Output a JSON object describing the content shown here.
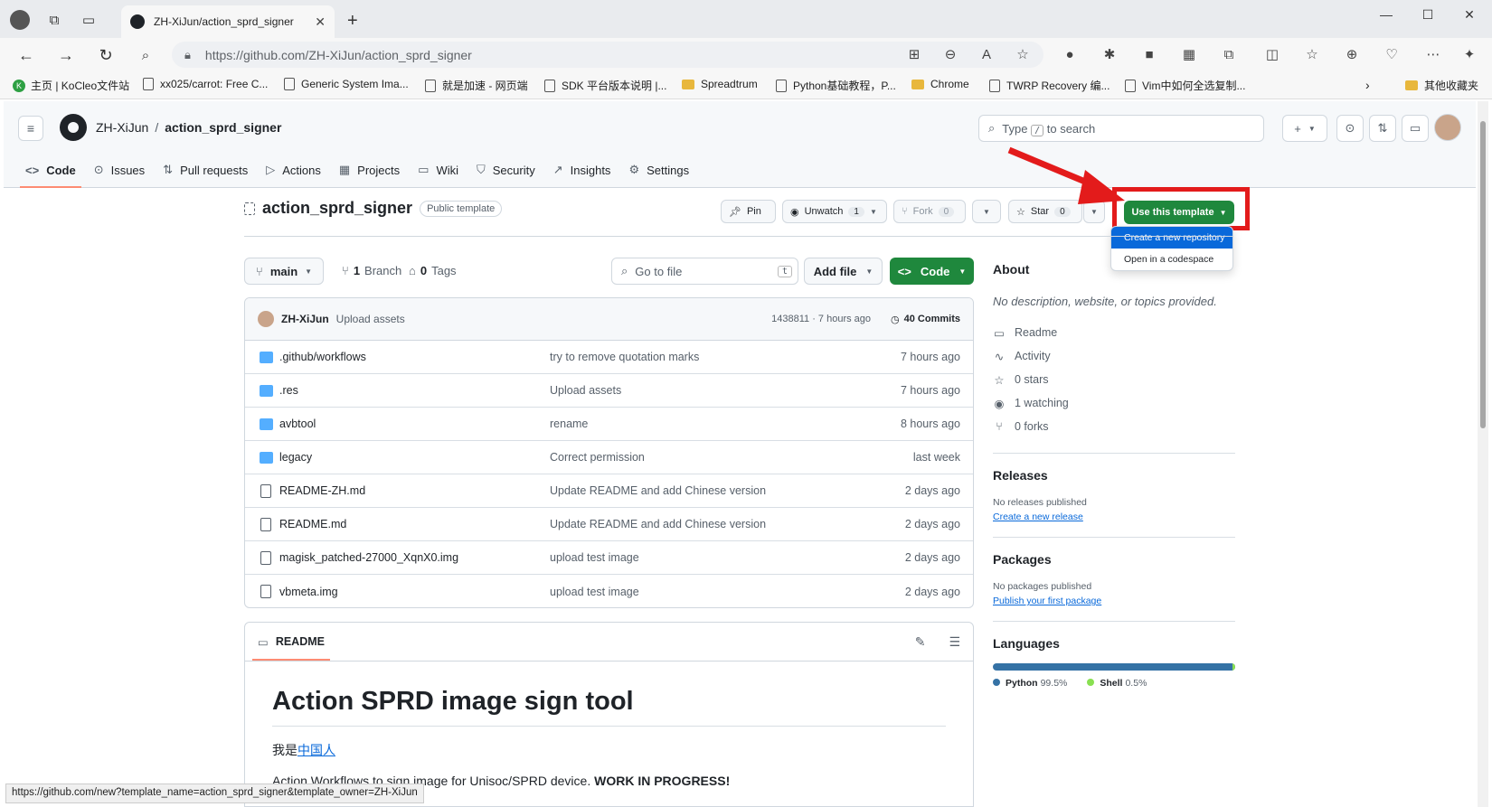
{
  "browser": {
    "tab_title": "ZH-XiJun/action_sprd_signer",
    "url": "https://github.com/ZH-XiJun/action_sprd_signer",
    "bookmarks": [
      "主页 | KoCleo文件站",
      "xx025/carrot: Free C...",
      "Generic System Ima...",
      "就是加速 - 网页端",
      "SDK 平台版本说明 |...",
      "Spreadtrum",
      "Python基础教程，P...",
      "Chrome",
      "TWRP Recovery 编...",
      "Vim中如何全选复制...",
      "其他收藏夹"
    ],
    "status_url": "https://github.com/new?template_name=action_sprd_signer&template_owner=ZH-XiJun"
  },
  "header": {
    "owner": "ZH-XiJun",
    "separator": "/",
    "repo": "action_sprd_signer",
    "search_prefix": "Type",
    "search_key": "/",
    "search_suffix": "to search"
  },
  "repo_tabs": [
    {
      "label": "Code",
      "icon": "<>"
    },
    {
      "label": "Issues",
      "icon": "⊙"
    },
    {
      "label": "Pull requests",
      "icon": "⇅"
    },
    {
      "label": "Actions",
      "icon": "▷"
    },
    {
      "label": "Projects",
      "icon": "▦"
    },
    {
      "label": "Wiki",
      "icon": "▭"
    },
    {
      "label": "Security",
      "icon": "⛉"
    },
    {
      "label": "Insights",
      "icon": "↗"
    },
    {
      "label": "Settings",
      "icon": "⚙"
    }
  ],
  "repo": {
    "name": "action_sprd_signer",
    "visibility": "Public template",
    "pin": "Pin",
    "unwatch": "Unwatch",
    "watch_count": "1",
    "fork": "Fork",
    "fork_count": "0",
    "star": "Star",
    "star_count": "0",
    "use_template": "Use this template"
  },
  "template_menu": {
    "create_repo": "Create a new repository",
    "open_codespace": "Open in a codespace"
  },
  "controls": {
    "branch": "main",
    "branches_count": "1",
    "branches_label": "Branch",
    "tags_count": "0",
    "tags_label": "Tags",
    "goto_placeholder": "Go to file",
    "goto_key": "t",
    "add_file": "Add file",
    "code": "Code"
  },
  "latest_commit": {
    "author": "ZH-XiJun",
    "message": "Upload assets",
    "hash_time": "1438811 · 7 hours ago",
    "commits": "40 Commits"
  },
  "files": [
    {
      "name": ".github/workflows",
      "type": "dir",
      "message": "try to remove quotation marks",
      "time": "7 hours ago"
    },
    {
      "name": ".res",
      "type": "dir",
      "message": "Upload assets",
      "time": "7 hours ago"
    },
    {
      "name": "avbtool",
      "type": "dir",
      "message": "rename",
      "time": "8 hours ago"
    },
    {
      "name": "legacy",
      "type": "dir",
      "message": "Correct permission",
      "time": "last week"
    },
    {
      "name": "README-ZH.md",
      "type": "file",
      "message": "Update README and add Chinese version",
      "time": "2 days ago"
    },
    {
      "name": "README.md",
      "type": "file",
      "message": "Update README and add Chinese version",
      "time": "2 days ago"
    },
    {
      "name": "magisk_patched-27000_XqnX0.img",
      "type": "file",
      "message": "upload test image",
      "time": "2 days ago"
    },
    {
      "name": "vbmeta.img",
      "type": "file",
      "message": "upload test image",
      "time": "2 days ago"
    }
  ],
  "readme": {
    "tab": "README",
    "title": "Action SPRD image sign tool",
    "line1_prefix": "我是",
    "line1_link": "中国人",
    "line2_text": "Action Workflows to sign image for Unisoc/SPRD device.",
    "line2_bold": "WORK IN PROGRESS!"
  },
  "about": {
    "title": "About",
    "description": "No description, website, or topics provided.",
    "items": [
      {
        "icon": "book-icon",
        "label": "Readme"
      },
      {
        "icon": "pulse-icon",
        "label": "Activity"
      },
      {
        "icon": "star-icon",
        "label": "0 stars"
      },
      {
        "icon": "eye-icon",
        "label": "1 watching"
      },
      {
        "icon": "fork-icon",
        "label": "0 forks"
      }
    ]
  },
  "releases": {
    "title": "Releases",
    "empty": "No releases published",
    "link": "Create a new release"
  },
  "packages": {
    "title": "Packages",
    "empty": "No packages published",
    "link": "Publish your first package"
  },
  "languages": {
    "title": "Languages",
    "list": [
      {
        "name": "Python",
        "percent": 99.5,
        "percent_label": "99.5%",
        "color": "#3572a5"
      },
      {
        "name": "Shell",
        "percent": 0.5,
        "percent_label": "0.5%",
        "color": "#89e051"
      }
    ]
  },
  "colors": {
    "accent_green": "#1f883d",
    "link_blue": "#0969da",
    "annotation_red": "#e31b1b"
  }
}
